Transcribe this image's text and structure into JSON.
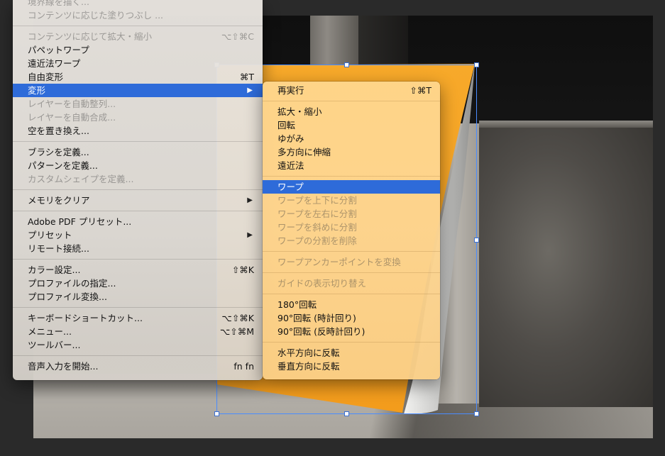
{
  "main_menu": {
    "items": [
      {
        "label": "境界線を描く...",
        "shortcut": "",
        "disabled": true,
        "submenu": false
      },
      {
        "label": "コンテンツに応じた塗りつぶし ...",
        "shortcut": "",
        "disabled": true,
        "submenu": false
      },
      {
        "sep": true
      },
      {
        "label": "コンテンツに応じて拡大・縮小",
        "shortcut": "⌥⇧⌘C",
        "disabled": true,
        "submenu": false
      },
      {
        "label": "パペットワープ",
        "shortcut": "",
        "disabled": false,
        "submenu": false
      },
      {
        "label": "遠近法ワープ",
        "shortcut": "",
        "disabled": false,
        "submenu": false
      },
      {
        "label": "自由変形",
        "shortcut": "⌘T",
        "disabled": false,
        "submenu": false
      },
      {
        "label": "変形",
        "shortcut": "",
        "disabled": false,
        "submenu": true,
        "selected": true
      },
      {
        "label": "レイヤーを自動整列...",
        "shortcut": "",
        "disabled": true,
        "submenu": false
      },
      {
        "label": "レイヤーを自動合成...",
        "shortcut": "",
        "disabled": true,
        "submenu": false
      },
      {
        "label": "空を置き換え...",
        "shortcut": "",
        "disabled": false,
        "submenu": false
      },
      {
        "sep": true
      },
      {
        "label": "ブラシを定義...",
        "shortcut": "",
        "disabled": false,
        "submenu": false
      },
      {
        "label": "パターンを定義...",
        "shortcut": "",
        "disabled": false,
        "submenu": false
      },
      {
        "label": "カスタムシェイプを定義...",
        "shortcut": "",
        "disabled": true,
        "submenu": false
      },
      {
        "sep": true
      },
      {
        "label": "メモリをクリア",
        "shortcut": "",
        "disabled": false,
        "submenu": true
      },
      {
        "sep": true
      },
      {
        "label": "Adobe PDF プリセット...",
        "shortcut": "",
        "disabled": false,
        "submenu": false
      },
      {
        "label": "プリセット",
        "shortcut": "",
        "disabled": false,
        "submenu": true
      },
      {
        "label": "リモート接続...",
        "shortcut": "",
        "disabled": false,
        "submenu": false
      },
      {
        "sep": true
      },
      {
        "label": "カラー設定...",
        "shortcut": "⇧⌘K",
        "disabled": false,
        "submenu": false
      },
      {
        "label": "プロファイルの指定...",
        "shortcut": "",
        "disabled": false,
        "submenu": false
      },
      {
        "label": "プロファイル変換...",
        "shortcut": "",
        "disabled": false,
        "submenu": false
      },
      {
        "sep": true
      },
      {
        "label": "キーボードショートカット...",
        "shortcut": "⌥⇧⌘K",
        "disabled": false,
        "submenu": false
      },
      {
        "label": "メニュー...",
        "shortcut": "⌥⇧⌘M",
        "disabled": false,
        "submenu": false
      },
      {
        "label": "ツールバー...",
        "shortcut": "",
        "disabled": false,
        "submenu": false
      },
      {
        "sep": true
      },
      {
        "label": "音声入力を開始...",
        "shortcut": "fn fn",
        "disabled": false,
        "submenu": false
      }
    ]
  },
  "sub_menu": {
    "items": [
      {
        "label": "再実行",
        "shortcut": "⇧⌘T",
        "disabled": false
      },
      {
        "sep": true
      },
      {
        "label": "拡大・縮小",
        "shortcut": "",
        "disabled": false
      },
      {
        "label": "回転",
        "shortcut": "",
        "disabled": false
      },
      {
        "label": "ゆがみ",
        "shortcut": "",
        "disabled": false
      },
      {
        "label": "多方向に伸縮",
        "shortcut": "",
        "disabled": false
      },
      {
        "label": "遠近法",
        "shortcut": "",
        "disabled": false
      },
      {
        "sep": true
      },
      {
        "label": "ワープ",
        "shortcut": "",
        "disabled": false,
        "selected": true
      },
      {
        "label": "ワープを上下に分割",
        "shortcut": "",
        "disabled": true
      },
      {
        "label": "ワープを左右に分割",
        "shortcut": "",
        "disabled": true
      },
      {
        "label": "ワープを斜めに分割",
        "shortcut": "",
        "disabled": true
      },
      {
        "label": "ワープの分割を削除",
        "shortcut": "",
        "disabled": true
      },
      {
        "sep": true
      },
      {
        "label": "ワープアンカーポイントを変換",
        "shortcut": "",
        "disabled": true
      },
      {
        "sep": true
      },
      {
        "label": "ガイドの表示切り替え",
        "shortcut": "",
        "disabled": true
      },
      {
        "sep": true
      },
      {
        "label": "180°回転",
        "shortcut": "",
        "disabled": false
      },
      {
        "label": "90°回転 (時計回り)",
        "shortcut": "",
        "disabled": false
      },
      {
        "label": "90°回転 (反時計回り)",
        "shortcut": "",
        "disabled": false
      },
      {
        "sep": true
      },
      {
        "label": "水平方向に反転",
        "shortcut": "",
        "disabled": false
      },
      {
        "label": "垂直方向に反転",
        "shortcut": "",
        "disabled": false
      }
    ]
  },
  "icons": {
    "submenu_arrow": "▶"
  },
  "colors": {
    "selection": "#2e6bd9",
    "paper": "#f5a623",
    "transform_box": "#4a8cff"
  }
}
